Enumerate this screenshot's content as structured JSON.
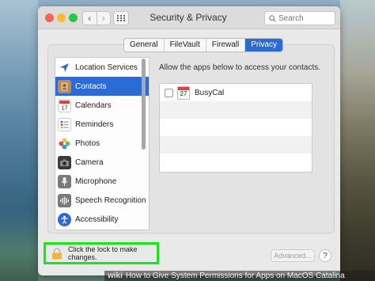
{
  "window": {
    "title": "Security & Privacy",
    "search_placeholder": "Search",
    "nav_back": "‹",
    "nav_forward": "›"
  },
  "tabs": [
    {
      "label": "General",
      "active": false
    },
    {
      "label": "FileVault",
      "active": false
    },
    {
      "label": "Firewall",
      "active": false
    },
    {
      "label": "Privacy",
      "active": true
    }
  ],
  "sidebar": {
    "items": [
      {
        "label": "Location Services",
        "icon": "location-arrow-icon",
        "selected": false
      },
      {
        "label": "Contacts",
        "icon": "contacts-book-icon",
        "selected": true
      },
      {
        "label": "Calendars",
        "icon": "calendar-icon",
        "selected": false
      },
      {
        "label": "Reminders",
        "icon": "reminders-list-icon",
        "selected": false
      },
      {
        "label": "Photos",
        "icon": "photos-flower-icon",
        "selected": false
      },
      {
        "label": "Camera",
        "icon": "camera-icon",
        "selected": false
      },
      {
        "label": "Microphone",
        "icon": "microphone-icon",
        "selected": false
      },
      {
        "label": "Speech Recognition",
        "icon": "speech-waveform-icon",
        "selected": false
      },
      {
        "label": "Accessibility",
        "icon": "accessibility-person-icon",
        "selected": false
      }
    ]
  },
  "content": {
    "label": "Allow the apps below to access your contacts.",
    "apps": [
      {
        "name": "BusyCal",
        "icon": "calendar-icon",
        "icon_day": "27",
        "checked": false
      }
    ]
  },
  "footer": {
    "lock_text": "Click the lock to make changes.",
    "advanced_label": "Advanced...",
    "help_label": "?"
  },
  "caption": {
    "brand": "wiki",
    "text": "How to Give System Permissions for Apps on MacOS Catalina"
  },
  "colors": {
    "accent": "#2c6bd5",
    "highlight_box": "#19e619"
  }
}
